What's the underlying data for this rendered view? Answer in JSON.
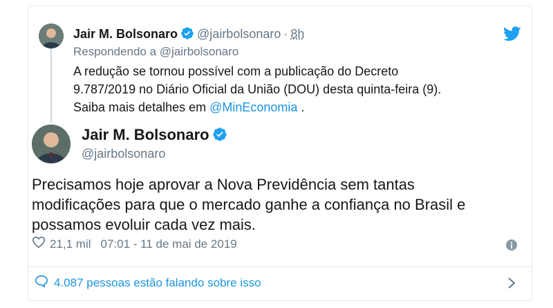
{
  "reply_tweet": {
    "name": "Jair M. Bolsonaro",
    "handle": "@jairbolsonaro",
    "separator": "·",
    "time": "8h",
    "replying_to": "Respondendo a @jairbolsonaro",
    "text_lines": [
      "A redução se tornou possível com a publicação do Decreto",
      "9.787/2019 no Diário Oficial da União (DOU) desta quinta-feira (9)."
    ],
    "text_last_prefix": "Saiba mais detalhes em ",
    "text_mention": "@MinEconomia",
    "text_last_suffix": " ."
  },
  "main_tweet": {
    "name": "Jair M. Bolsonaro",
    "handle": "@jairbolsonaro",
    "text_lines": [
      "Precisamos hoje aprovar a Nova Previdência sem tantas",
      "modificações para que o mercado ganhe a confiança no Brasil e",
      "possamos evoluir cada vez mais."
    ],
    "likes": "21,1 mil",
    "timestamp": "07:01 - 11 de mai de 2019"
  },
  "conversation": {
    "label": "4.087 pessoas estão falando sobre isso"
  },
  "colors": {
    "accent": "#1b95e0",
    "secondary_text": "#657786",
    "verified": "#1da1f2",
    "border": "#e1e8ed"
  },
  "icons": {
    "brand": "twitter-bird-icon",
    "verified": "verified-badge-icon",
    "like": "heart-icon",
    "info": "info-icon",
    "reply": "speech-bubble-icon",
    "more": "chevron-right-icon"
  }
}
